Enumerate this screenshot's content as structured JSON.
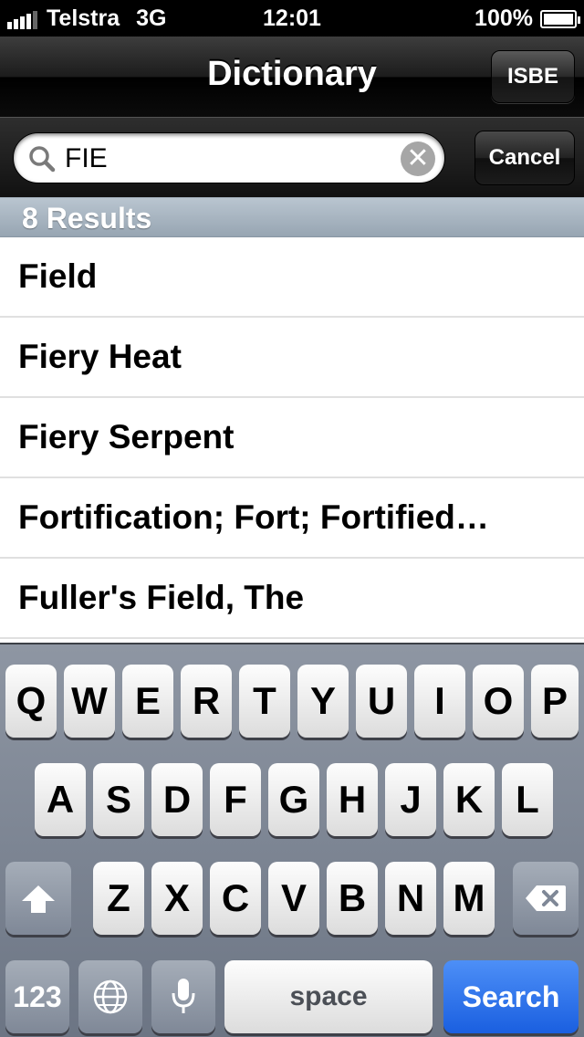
{
  "status_bar": {
    "carrier": "Telstra",
    "network": "3G",
    "time": "12:01",
    "battery": "100%"
  },
  "nav": {
    "title": "Dictionary",
    "right_button": "ISBE"
  },
  "search": {
    "value": "FIE",
    "clear_icon": "✕",
    "cancel_label": "Cancel"
  },
  "results": {
    "header": "8 Results",
    "items": [
      {
        "label": "Field"
      },
      {
        "label": "Fiery Heat"
      },
      {
        "label": "Fiery Serpent"
      },
      {
        "label": "Fortification; Fort; Fortified…"
      },
      {
        "label": "Fuller's Field, The"
      }
    ]
  },
  "keyboard": {
    "row1": [
      "Q",
      "W",
      "E",
      "R",
      "T",
      "Y",
      "U",
      "I",
      "O",
      "P"
    ],
    "row2": [
      "A",
      "S",
      "D",
      "F",
      "G",
      "H",
      "J",
      "K",
      "L"
    ],
    "row3": [
      "Z",
      "X",
      "C",
      "V",
      "B",
      "N",
      "M"
    ],
    "numbers_label": "123",
    "space_label": "space",
    "search_label": "Search"
  },
  "colors": {
    "search_key": "#1a5fe0",
    "section_header": "#97a5b2"
  }
}
